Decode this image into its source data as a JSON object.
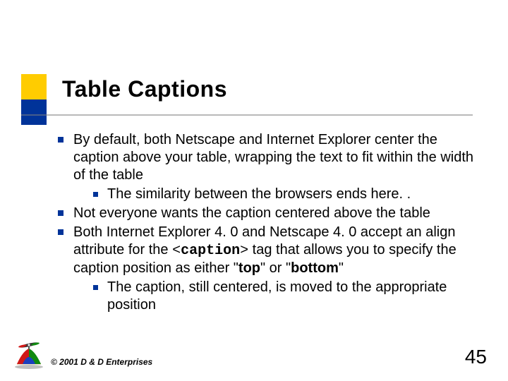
{
  "title": "Table Captions",
  "bullets": [
    {
      "text": "By default, both Netscape and Internet Explorer center the caption above your table, wrapping the text to fit within the width of the table",
      "sub": [
        {
          "text": "The similarity between the browsers ends here. ."
        }
      ]
    },
    {
      "text": "Not everyone wants the caption centered above the table",
      "sub": []
    },
    {
      "text_html": "Both Internet Explorer 4. 0 and Netscape 4. 0 accept an align attribute for the <span class=\"mono-tag\">&lt;<b>caption</b>&gt;</span> tag that allows you to specify the caption position as either \"<b>top</b>\" or \"<b>bottom</b>\"",
      "sub": [
        {
          "text": "The caption, still centered, is moved to the appropriate position"
        }
      ]
    }
  ],
  "footer": "© 2001 D & D Enterprises",
  "page_number": "45",
  "colors": {
    "accent_yellow": "#ffcc00",
    "accent_navy": "#003399"
  }
}
